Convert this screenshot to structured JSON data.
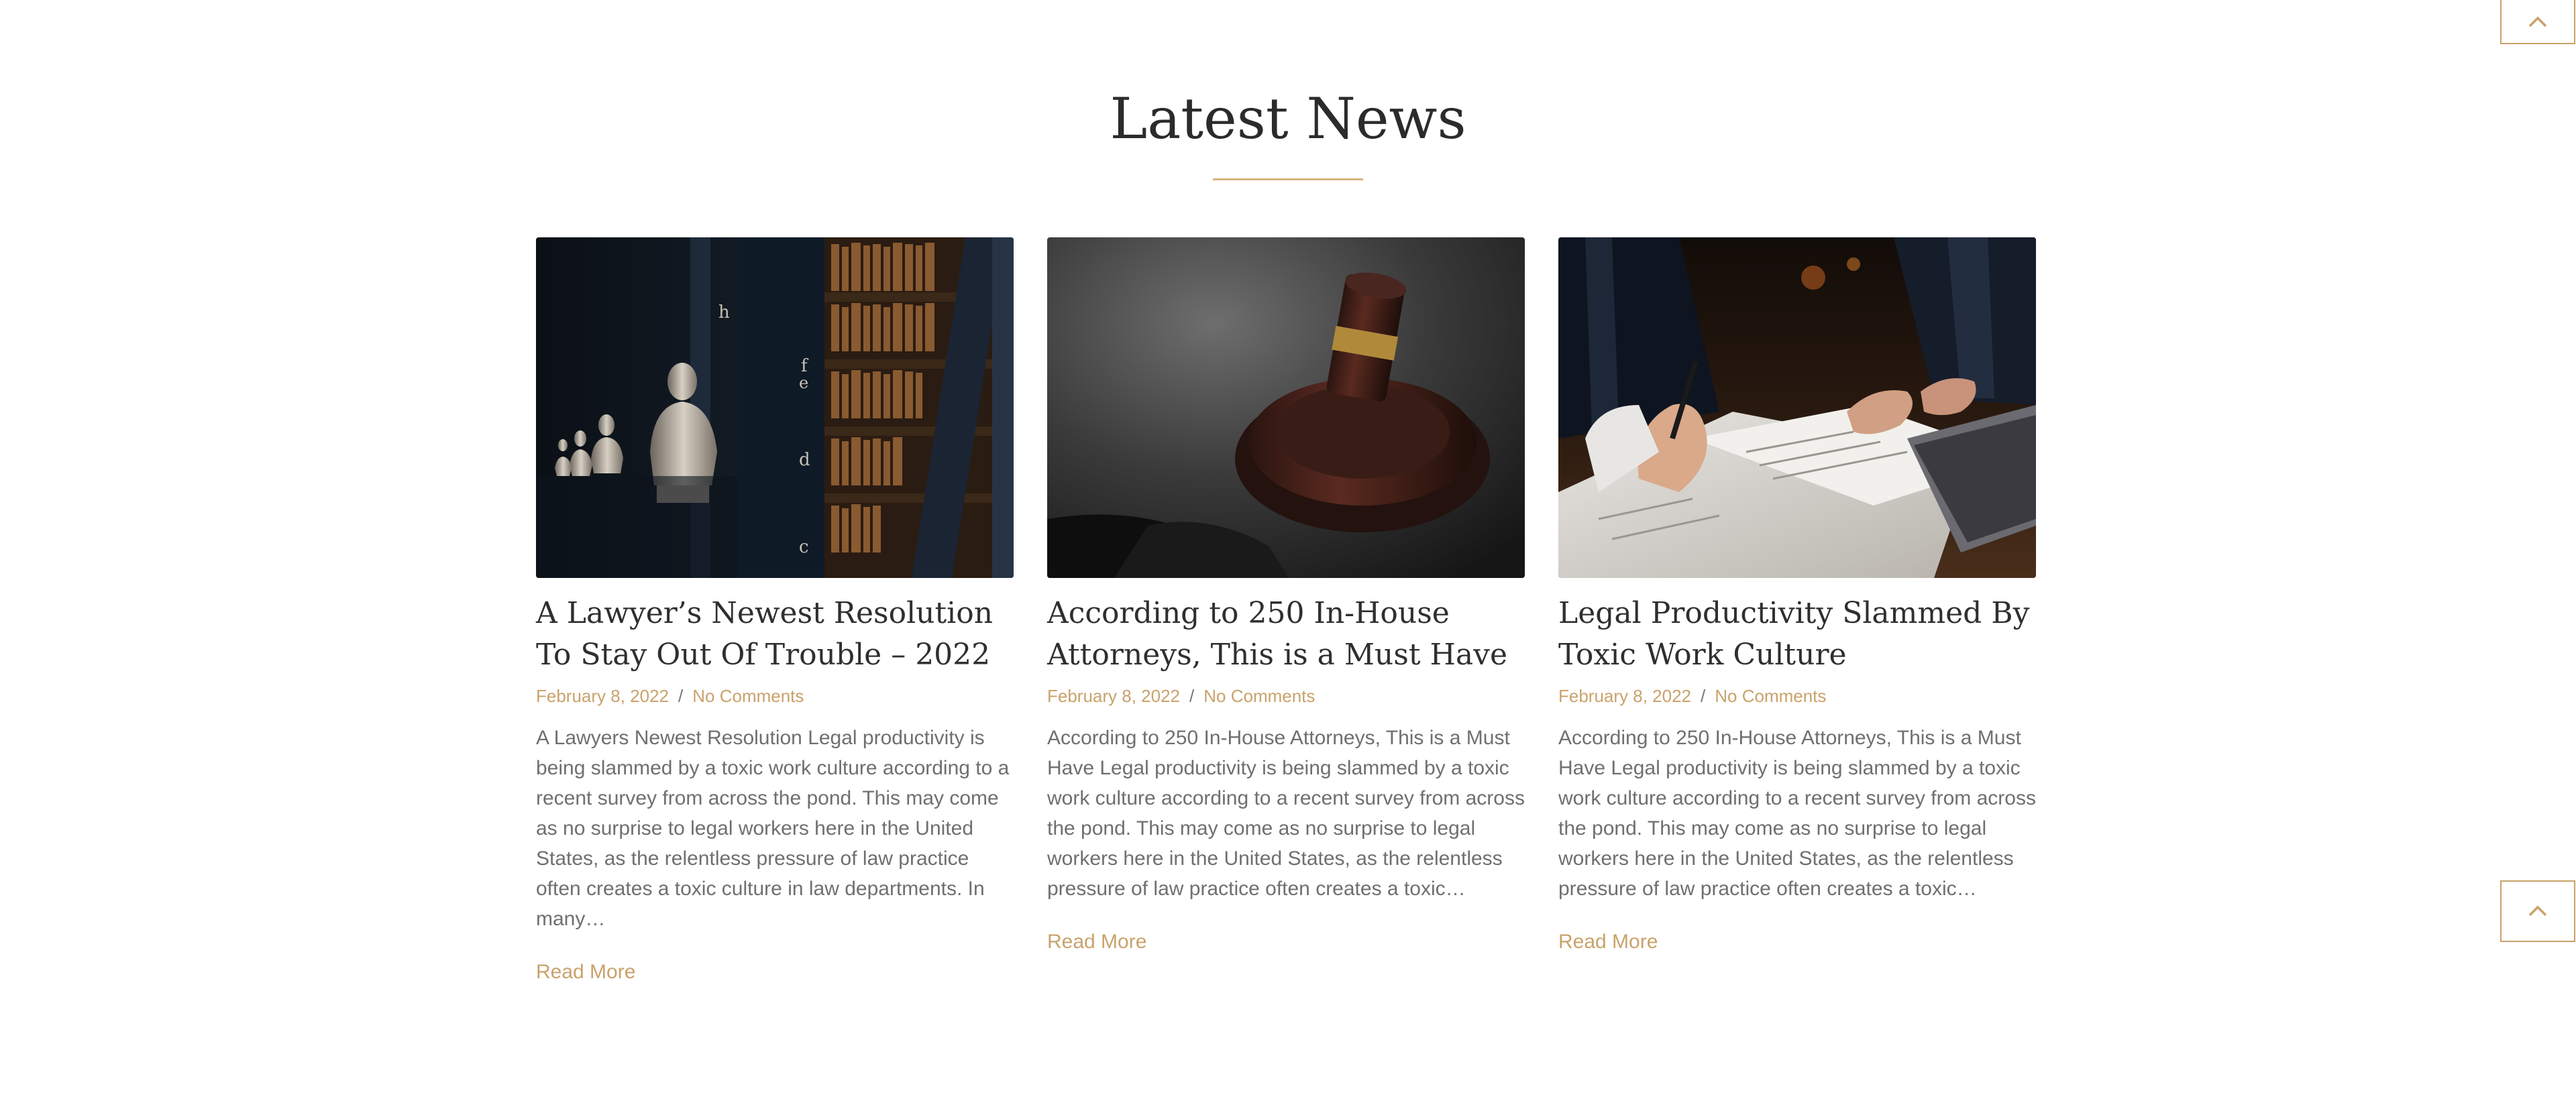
{
  "section": {
    "title": "Latest News"
  },
  "posts": [
    {
      "image": "law-library-busts-image",
      "title": "A Lawyer’s Newest Resolution To Stay Out Of Trouble – 2022",
      "date": "February 8, 2022",
      "separator": "/",
      "comments": "No Comments",
      "excerpt": "A Lawyers Newest Resolution Legal productivity is being slammed by a toxic work culture according to a recent survey from across the pond. This may come as no surprise to legal workers here in the United States, as the relentless pressure of law practice often creates a toxic culture in law departments. In many…",
      "read_more": "Read More"
    },
    {
      "image": "gavel-image",
      "title": "According to 250 In-House Attorneys, This is a Must Have",
      "date": "February 8, 2022",
      "separator": "/",
      "comments": "No Comments",
      "excerpt": "According to 250 In-House Attorneys, This is a Must Have Legal productivity is being slammed by a toxic work culture according to a recent survey from across the pond. This may come as no surprise to legal workers here in the United States, as the relentless pressure of law practice often creates a toxic…",
      "read_more": "Read More"
    },
    {
      "image": "signing-contract-image",
      "title": "Legal Productivity Slammed By Toxic Work Culture",
      "date": "February 8, 2022",
      "separator": "/",
      "comments": "No Comments",
      "excerpt": "According to 250 In-House Attorneys, This is a Must Have Legal productivity is being slammed by a toxic work culture according to a recent survey from across the pond. This may come as no surprise to legal workers here in the United States, as the relentless pressure of law practice often creates a toxic…",
      "read_more": "Read More"
    }
  ],
  "scroll_buttons": [
    {
      "icon": "chevron-up-icon"
    },
    {
      "icon": "chevron-up-icon"
    }
  ],
  "colors": {
    "accent": "#c9a26b",
    "rule": "#d7b27d",
    "heading": "#2b2b2b",
    "body_text": "#6f6f6f"
  }
}
